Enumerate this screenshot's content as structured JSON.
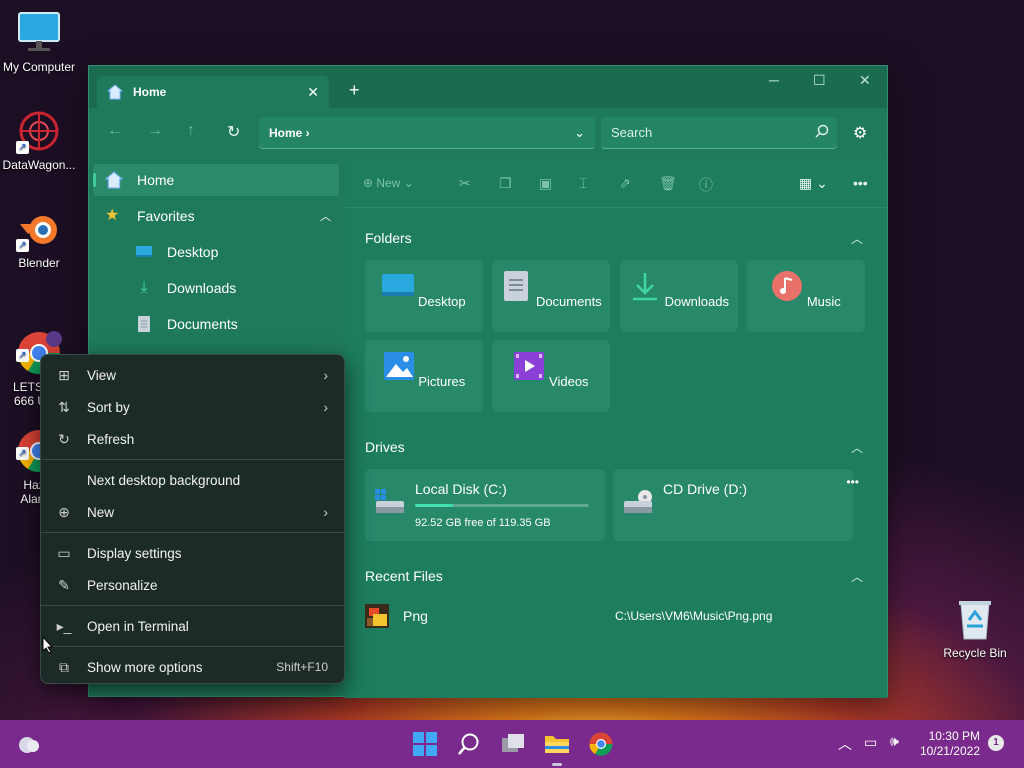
{
  "desktop": {
    "icons": [
      {
        "label": "My Computer",
        "icon": "monitor-icon"
      },
      {
        "label": "DataWagon...",
        "icon": "datawagon-icon"
      },
      {
        "label": "Blender",
        "icon": "blender-icon"
      },
      {
        "label": "LETS C...\n666 US...",
        "icon": "chrome-icon"
      },
      {
        "label": "Haz...\nAlam...",
        "icon": "chrome-icon"
      },
      {
        "label": "Recycle Bin",
        "icon": "recycle-bin-icon"
      }
    ]
  },
  "explorer": {
    "tab_title": "Home",
    "new_tab": "+",
    "address": {
      "crumb": "Home"
    },
    "search": {
      "placeholder": "Search"
    },
    "sidebar": {
      "home": "Home",
      "favorites": "Favorites",
      "items": [
        "Desktop",
        "Downloads",
        "Documents"
      ]
    },
    "cmdbar": {
      "new_label": "New"
    },
    "folders": {
      "heading": "Folders",
      "items": [
        "Desktop",
        "Documents",
        "Downloads",
        "Music",
        "Pictures",
        "Videos"
      ]
    },
    "drives": {
      "heading": "Drives",
      "items": [
        {
          "name": "Local Disk (C:)",
          "free": "92.52 GB free of 119.35 GB",
          "used_fraction": 0.22
        },
        {
          "name": "CD Drive (D:)"
        }
      ]
    },
    "recent": {
      "heading": "Recent Files",
      "files": [
        {
          "name": "Png",
          "path": "C:\\Users\\VM6\\Music\\Png.png"
        }
      ]
    }
  },
  "context_menu": {
    "items": [
      {
        "label": "View",
        "icon": "grid-icon",
        "submenu": true
      },
      {
        "label": "Sort by",
        "icon": "sort-icon",
        "submenu": true
      },
      {
        "label": "Refresh",
        "icon": "refresh-icon"
      },
      {
        "label": "Next desktop background"
      },
      {
        "label": "New",
        "icon": "plus-circle-icon",
        "submenu": true
      },
      {
        "label": "Display settings",
        "icon": "display-icon"
      },
      {
        "label": "Personalize",
        "icon": "brush-icon"
      },
      {
        "label": "Open in Terminal",
        "icon": "terminal-icon"
      },
      {
        "label": "Show more options",
        "icon": "share-icon",
        "shortcut": "Shift+F10"
      }
    ]
  },
  "taskbar": {
    "time": "10:30 PM",
    "date": "10/21/2022",
    "notifications": "1"
  },
  "colors": {
    "window_bg": "#1f7a5c",
    "taskbar": "#7a2a8c",
    "menu_bg": "#1d2b28"
  }
}
